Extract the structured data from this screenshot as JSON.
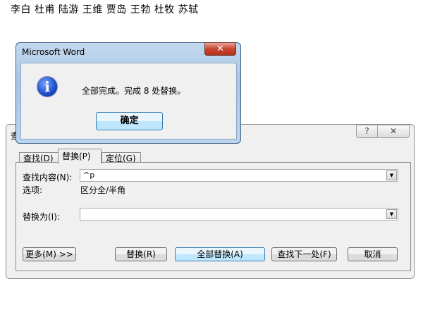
{
  "document": {
    "text": "李白 杜甫 陆游 王维 贾岛 王勃 杜牧 苏轼"
  },
  "find_replace": {
    "title": "查",
    "help": "?",
    "close": "✕",
    "tabs": [
      {
        "label": "查找(D)"
      },
      {
        "label": "替换(P)"
      },
      {
        "label": "定位(G)"
      }
    ],
    "find_label": "查找内容(N):",
    "find_value": "^p",
    "options_label": "选项:",
    "options_value": "区分全/半角",
    "replace_label": "替换为(I):",
    "replace_value": "",
    "buttons": {
      "more": "更多(M) >>",
      "replace": "替换(R)",
      "replace_all": "全部替换(A)",
      "find_next": "查找下一处(F)",
      "cancel": "取消"
    }
  },
  "message_box": {
    "title": "Microsoft Word",
    "close": "✕",
    "icon": "info-icon",
    "message": "全部完成。完成 8 处替换。",
    "ok": "确定"
  }
}
